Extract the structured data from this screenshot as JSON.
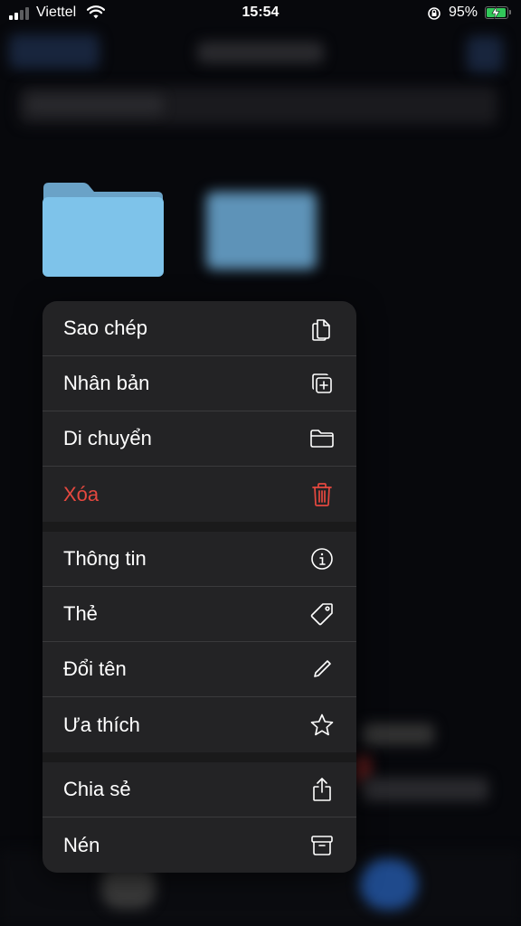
{
  "status_bar": {
    "carrier": "Viettel",
    "time": "15:54",
    "battery_percent": "95%",
    "battery_level": 0.95,
    "signal_bars": 2
  },
  "menu": {
    "groups": [
      [
        {
          "label": "Sao chép",
          "icon": "copy-icon"
        },
        {
          "label": "Nhân bản",
          "icon": "duplicate-icon"
        },
        {
          "label": "Di chuyển",
          "icon": "folder-icon"
        },
        {
          "label": "Xóa",
          "icon": "trash-icon",
          "destructive": true
        }
      ],
      [
        {
          "label": "Thông tin",
          "icon": "info-icon"
        },
        {
          "label": "Thẻ",
          "icon": "tag-icon"
        },
        {
          "label": "Đổi tên",
          "icon": "pencil-icon"
        },
        {
          "label": "Ưa thích",
          "icon": "star-icon"
        }
      ],
      [
        {
          "label": "Chia sẻ",
          "icon": "share-icon"
        },
        {
          "label": "Nén",
          "icon": "archive-icon"
        }
      ]
    ]
  },
  "colors": {
    "destructive": "#e5483f",
    "folder": "#7ec3ea",
    "menu_bg": "#232325"
  }
}
